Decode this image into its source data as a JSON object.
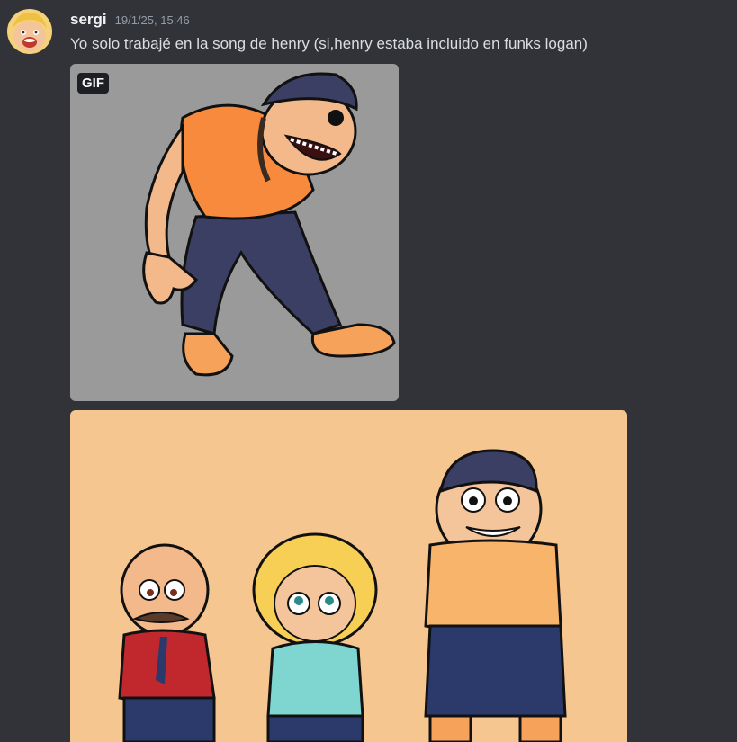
{
  "message": {
    "author": "sergi",
    "timestamp": "19/1/25, 15:46",
    "text": "Yo solo trabajé en la song de henry (si,henry estaba incluido en funks logan)"
  },
  "attachments": {
    "gif_badge": "GIF"
  },
  "colors": {
    "background": "#313338",
    "gif_background": "#9a9a9a",
    "image_background": "#f5c690",
    "username": "#f2f3f5",
    "timestamp": "#949ba4",
    "text": "#dbdee1"
  }
}
